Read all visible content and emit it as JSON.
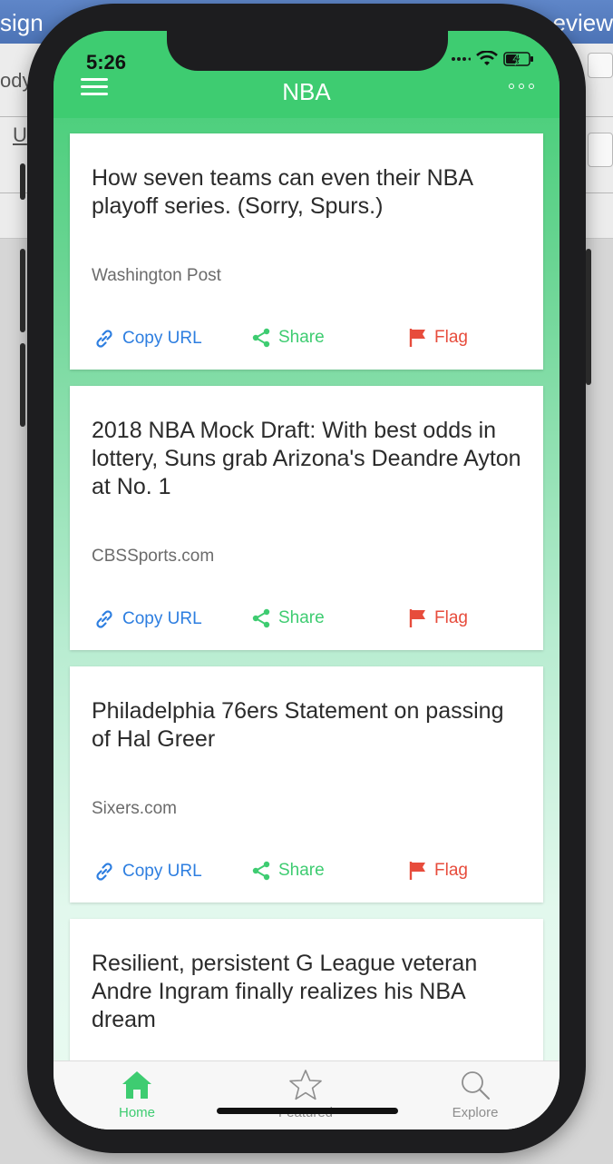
{
  "desktop": {
    "title_left": "sign",
    "title_right": "eview",
    "left_text_1": "ody",
    "left_text_2": "U"
  },
  "status": {
    "time": "5:26"
  },
  "header": {
    "title": "NBA"
  },
  "icons": {
    "menu": "menu-icon",
    "more": "more-icon",
    "link": "link-icon",
    "share": "share-icon",
    "flag": "flag-icon",
    "home": "home-icon",
    "star": "star-icon",
    "search": "search-icon"
  },
  "colors": {
    "accent": "#3ecc71",
    "link": "#2d7ee0",
    "flag": "#e74c3c",
    "text": "#2b2b2b",
    "muted": "#6b6b6b"
  },
  "actions": {
    "copy_label": "Copy URL",
    "share_label": "Share",
    "flag_label": "Flag"
  },
  "cards": [
    {
      "title": "How seven teams can even their NBA playoff series. (Sorry, Spurs.)",
      "source": "Washington Post"
    },
    {
      "title": "2018 NBA Mock Draft: With best odds in lottery, Suns grab Arizona's Deandre Ayton at No. 1",
      "source": "CBSSports.com"
    },
    {
      "title": "Philadelphia 76ers Statement on passing of Hal Greer",
      "source": "Sixers.com"
    },
    {
      "title": "Resilient, persistent G League veteran Andre Ingram finally realizes his NBA dream",
      "source": ""
    }
  ],
  "tabs": [
    {
      "label": "Home",
      "active": true
    },
    {
      "label": "Featured",
      "active": false
    },
    {
      "label": "Explore",
      "active": false
    }
  ]
}
